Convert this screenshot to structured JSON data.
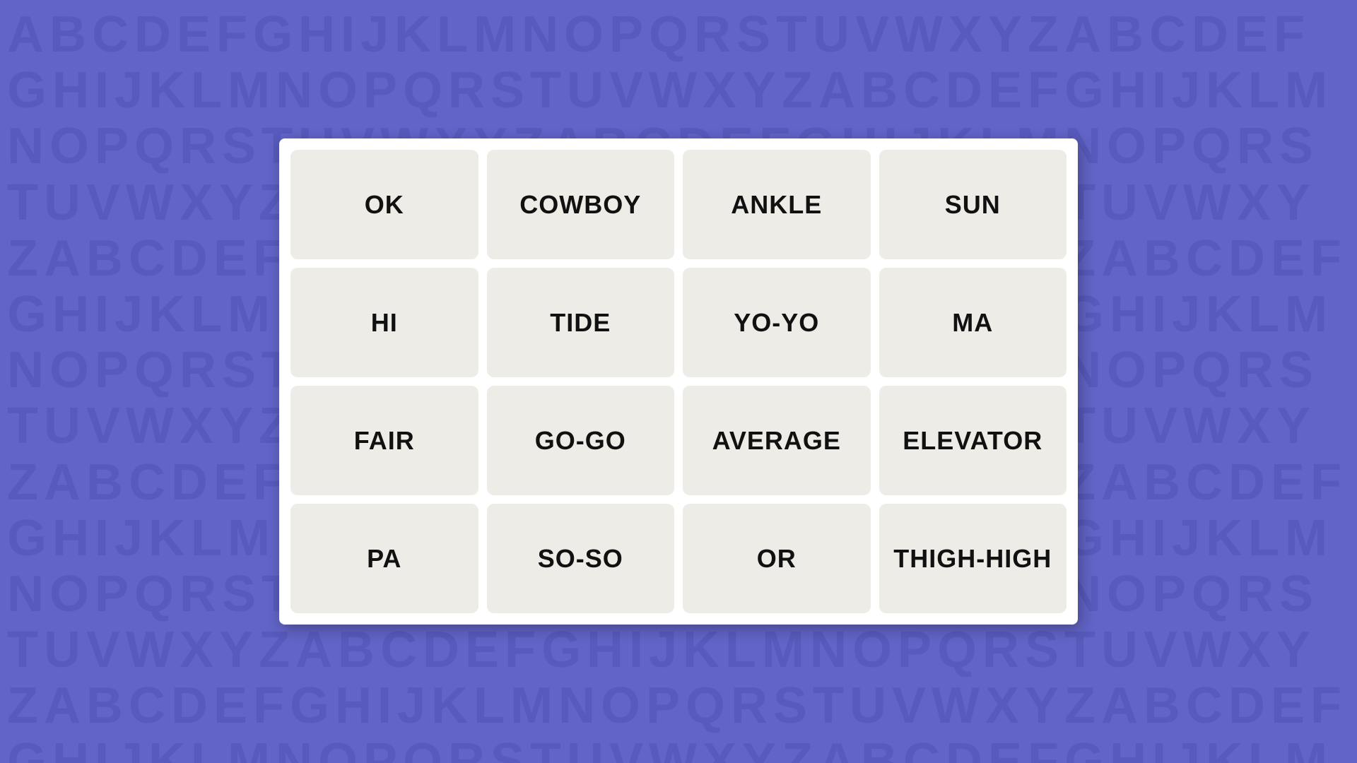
{
  "background": {
    "letters": "ABCDEFGHIJKLMNOPQRSTUVWXYZABCDEFGHIJKLMNOPQRSTUVWXYZABCDEFGHIJKLMNOPQRSTUVWXYZABCDEFGHIJKLMNOPQRSTUVWXYZABCDEFGHIJKLMNOPQRSTUVWXYZABCDEFGHIJKLMNOPQRSTUVWXYZABCDEFGHIJKLMNOPQRSTUVWXYZABCDEFGHIJKLMNOPQRSTUVWXYZABCDEFGHIJKLMNOPQRSTUVWXYZABCDEFGHIJKLMNOPQRSTUVWXYZ"
  },
  "grid": {
    "cells": [
      {
        "id": "ok",
        "label": "OK"
      },
      {
        "id": "cowboy",
        "label": "COWBOY"
      },
      {
        "id": "ankle",
        "label": "ANKLE"
      },
      {
        "id": "sun",
        "label": "SUN"
      },
      {
        "id": "hi",
        "label": "HI"
      },
      {
        "id": "tide",
        "label": "TIDE"
      },
      {
        "id": "yo-yo",
        "label": "YO-YO"
      },
      {
        "id": "ma",
        "label": "MA"
      },
      {
        "id": "fair",
        "label": "FAIR"
      },
      {
        "id": "go-go",
        "label": "GO-GO"
      },
      {
        "id": "average",
        "label": "AVERAGE"
      },
      {
        "id": "elevator",
        "label": "ELEVATOR"
      },
      {
        "id": "pa",
        "label": "PA"
      },
      {
        "id": "so-so",
        "label": "SO-SO"
      },
      {
        "id": "or",
        "label": "OR"
      },
      {
        "id": "thigh-high",
        "label": "THIGH-HIGH"
      }
    ]
  }
}
